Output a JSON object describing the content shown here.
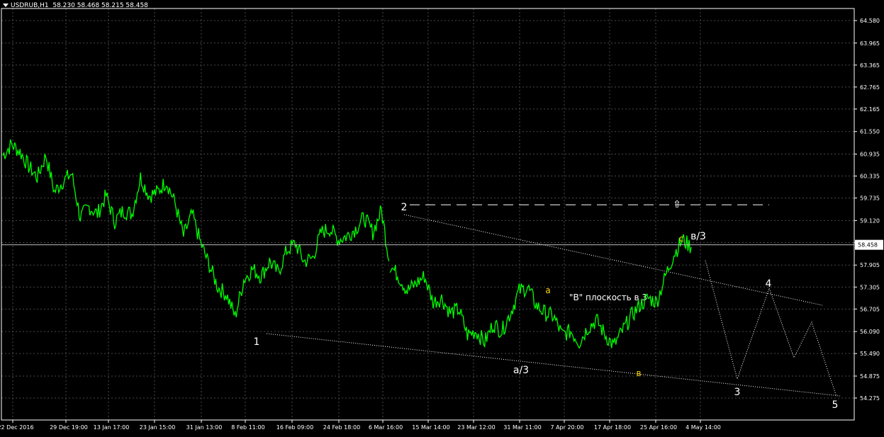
{
  "header": {
    "symbol": "USDRUB,H1",
    "ohlc": "58.230 58.468 58.215 58.458"
  },
  "colors": {
    "background": "#000000",
    "grid": "#4a4a4a",
    "price_series": "#00ff00",
    "axis_text": "#ffffff",
    "wave_label": "#ffffff",
    "subwave_label": "#ffd700",
    "current_price_tag": "#ffffff"
  },
  "chart_data": {
    "type": "line",
    "title": "",
    "xlabel": "",
    "ylabel": "",
    "ylim": [
      54.275,
      64.9
    ],
    "grid": true,
    "y_ticks": [
      "64.580",
      "63.965",
      "63.365",
      "62.765",
      "62.165",
      "61.550",
      "60.935",
      "60.335",
      "59.735",
      "59.120",
      "58.520",
      "57.905",
      "57.305",
      "56.705",
      "56.090",
      "55.490",
      "54.875",
      "54.275"
    ],
    "y_tick_values": [
      64.58,
      63.965,
      63.365,
      62.765,
      62.165,
      61.55,
      60.935,
      60.335,
      59.735,
      59.12,
      58.52,
      57.905,
      57.305,
      56.705,
      56.09,
      55.49,
      54.875,
      54.275
    ],
    "x_ticks": [
      "22 Dec 2016",
      "29 Dec 19:00",
      "13 Jan 17:00",
      "23 Jan 15:00",
      "31 Jan 13:00",
      "8 Feb 11:00",
      "16 Feb 09:00",
      "24 Feb 18:00",
      "6 Mar 16:00",
      "15 Mar 14:00",
      "23 Mar 12:00",
      "31 Mar 11:00",
      "7 Apr 20:00",
      "17 Apr 18:00",
      "25 Apr 16:00",
      "4 May 14:00"
    ],
    "current_price": "58.458",
    "current_price_value": 58.458,
    "series": [
      {
        "values": [
          60.9,
          61.2,
          61.0,
          60.6,
          60.3,
          60.9,
          59.9,
          60.2,
          60.4,
          59.2,
          59.5,
          59.3,
          59.8,
          59.1,
          59.4,
          59.3,
          60.3,
          59.8,
          59.9,
          60.2,
          59.6,
          58.7,
          59.3,
          58.5,
          57.9,
          57.3,
          57.1,
          56.5,
          57.5,
          57.8,
          57.6,
          58.0,
          57.7,
          58.3,
          58.5,
          58.0,
          58.1,
          58.8,
          58.9,
          58.6,
          58.7,
          58.9,
          59.2,
          58.8,
          59.4,
          57.9,
          57.6,
          57.2,
          57.4,
          57.6,
          56.9,
          57.0,
          56.6,
          56.7,
          56.0,
          56.1,
          55.8,
          56.3,
          56.1,
          56.6,
          57.2,
          57.3,
          56.8,
          56.6,
          56.5,
          56.0,
          56.1,
          55.8,
          56.2,
          56.4,
          56.0,
          55.7,
          56.1,
          56.5,
          56.8,
          57.0,
          56.9,
          57.6,
          58.2,
          58.6,
          58.4
        ]
      }
    ],
    "overlays": {
      "horizontal_level": 59.55,
      "wave_labels": [
        {
          "text": "1",
          "kind": "main"
        },
        {
          "text": "2",
          "kind": "main"
        },
        {
          "text": "a/3",
          "kind": "main"
        },
        {
          "text": "a",
          "kind": "sub"
        },
        {
          "text": "в",
          "kind": "sub"
        },
        {
          "text": "c",
          "kind": "sub"
        },
        {
          "text": "в/3",
          "kind": "main"
        },
        {
          "text": "3",
          "kind": "main"
        },
        {
          "text": "4",
          "kind": "main"
        },
        {
          "text": "5",
          "kind": "main"
        }
      ],
      "annotation": "\"B\" плоскость в 3",
      "arrow_glyph": "⇧"
    }
  }
}
